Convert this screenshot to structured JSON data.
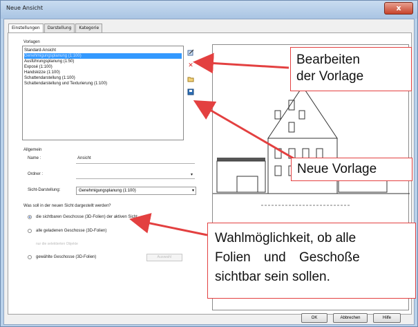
{
  "window": {
    "title": "Neue Ansicht",
    "close_symbol": "x"
  },
  "tabs": [
    {
      "label": "Einstellungen",
      "active": true
    },
    {
      "label": "Darstellung",
      "active": false
    },
    {
      "label": "Kategorie",
      "active": false
    }
  ],
  "templates": {
    "section_label": "Vorlagen",
    "items": [
      {
        "label": "Standard-Ansicht",
        "selected": false
      },
      {
        "label": "Genehmigungsplanung (1:100)",
        "selected": true
      },
      {
        "label": "Ausführungsplanung (1:50)",
        "selected": false
      },
      {
        "label": "Exposé (1:100)",
        "selected": false
      },
      {
        "label": "Handskizze (1:100)",
        "selected": false
      },
      {
        "label": "Schattendarstellung (1:100)",
        "selected": false
      },
      {
        "label": "Schattendarstellung und Texturierung (1:100)",
        "selected": false
      }
    ],
    "tool_icons": [
      "edit-template-icon",
      "delete-template-icon",
      "open-folder-icon",
      "save-template-icon"
    ]
  },
  "general": {
    "section_label": "Allgemein",
    "name_label": "Name :",
    "name_value": "Ansicht",
    "folder_label": "Ordner :",
    "folder_value": "",
    "view_repr_label": "Sicht-Darstellung:",
    "view_repr_value": "Genehmigungsplanung (1:100)"
  },
  "visibility": {
    "question": "Was soll in der neuen Sicht dargestellt werden?",
    "options": [
      {
        "label": "die sichtbaren Geschosse (3D-Folien) der aktiven Sicht",
        "checked": true,
        "enabled": true
      },
      {
        "label": "alle geladenen Geschosse (3D-Folien)",
        "checked": false,
        "enabled": true
      },
      {
        "label": "nur die selektierten Objekte",
        "checked": false,
        "enabled": false
      },
      {
        "label": "gewählte Geschosse (3D-Folien)",
        "checked": false,
        "enabled": true
      }
    ],
    "select_button": "Auswahl"
  },
  "buttons": {
    "ok": "OK",
    "cancel": "Abbrechen",
    "help": "Hilfe"
  },
  "callouts": {
    "edit": [
      "Bearbeiten",
      "der Vorlage"
    ],
    "new": "Neue Vorlage",
    "choice": [
      "Wahlmöglichkeit, ob alle",
      "Folien und Geschoße",
      "sichtbar sein sollen."
    ]
  },
  "colors": {
    "accent_red": "#e34040",
    "selection_blue": "#3399ff",
    "title_bar": "#b9d1ea"
  }
}
